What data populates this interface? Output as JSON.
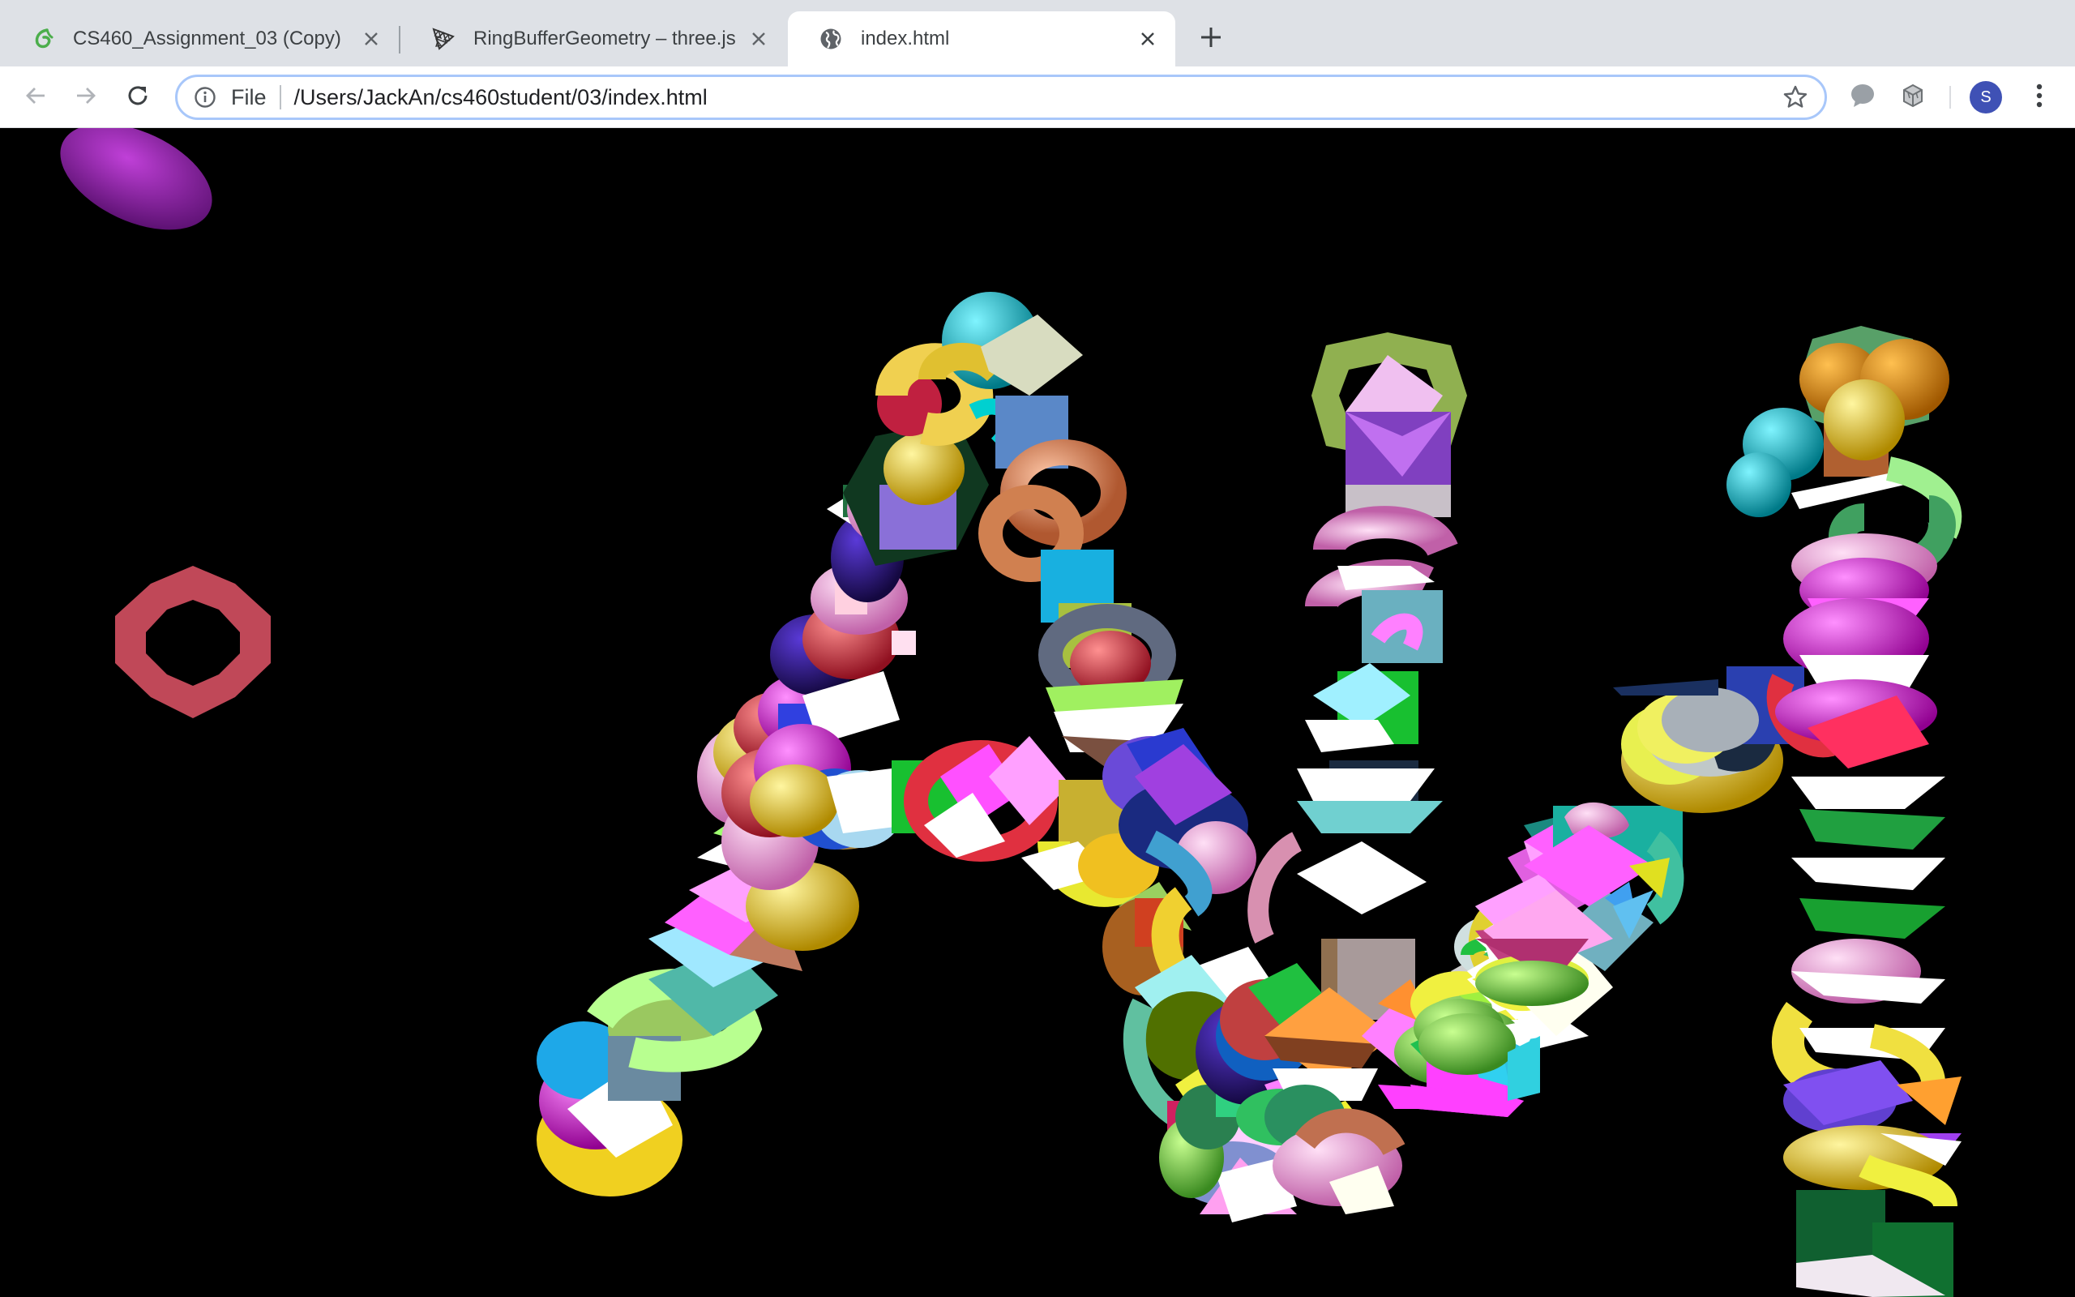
{
  "tabs": [
    {
      "title": "CS460_Assignment_03 (Copy)",
      "icon": "overleaf-leaf-icon",
      "active": false
    },
    {
      "title": "RingBufferGeometry – three.js",
      "icon": "threejs-logo-icon",
      "active": false
    },
    {
      "title": "index.html",
      "icon": "globe-icon",
      "active": true
    }
  ],
  "omnibox": {
    "scheme_label": "File",
    "url": "/Users/JackAn/cs460student/03/index.html"
  },
  "profile": {
    "initial": "S",
    "color": "#3f51b5"
  },
  "icons": {
    "back": "arrow-left-icon",
    "forward": "arrow-right-icon",
    "reload": "reload-icon",
    "info": "info-icon",
    "bookmark": "star-icon",
    "extension1": "speech-bubble-icon",
    "extension2": "cube-extension-icon",
    "menu": "kebab-menu-icon",
    "new_tab": "plus-icon",
    "close": "close-icon"
  },
  "scene": {
    "background": "#000000",
    "text_rendered": "AN",
    "palette": [
      "#00c8d8",
      "#f0d040",
      "#a070e0",
      "#ff40ff",
      "#ffffff",
      "#20c040",
      "#d04050",
      "#ff9030",
      "#4080d0",
      "#9ad060",
      "#ffb0e0",
      "#2040a0",
      "#006030",
      "#40c0a0"
    ]
  }
}
